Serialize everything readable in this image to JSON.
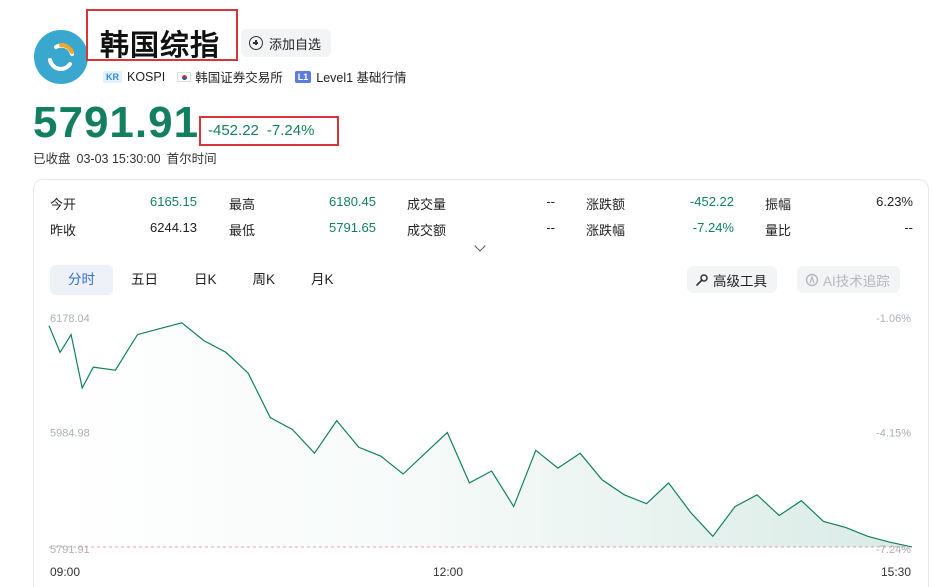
{
  "header": {
    "name": "韩国综指",
    "watch_label": "添加自选",
    "market_tag": "KR",
    "symbol": "KOSPI",
    "exchange": "韩国证券交易所",
    "level_tag": "L1",
    "level_label": "Level1 基础行情"
  },
  "quote": {
    "price": "5791.91",
    "change": "-452.22",
    "change_pct": "-7.24%",
    "status": "已收盘",
    "datetime": "03-03 15:30:00",
    "timezone": "首尔时间"
  },
  "stats": {
    "rows": [
      [
        {
          "label": "今开",
          "value": "6165.15",
          "tone": "green"
        },
        {
          "label": "最高",
          "value": "6180.45",
          "tone": "green"
        },
        {
          "label": "成交量",
          "value": "--",
          "tone": "dark"
        },
        {
          "label": "涨跌额",
          "value": "-452.22",
          "tone": "green"
        },
        {
          "label": "振幅",
          "value": "6.23%",
          "tone": "dark"
        }
      ],
      [
        {
          "label": "昨收",
          "value": "6244.13",
          "tone": "dark"
        },
        {
          "label": "最低",
          "value": "5791.65",
          "tone": "green"
        },
        {
          "label": "成交额",
          "value": "--",
          "tone": "dark"
        },
        {
          "label": "涨跌幅",
          "value": "-7.24%",
          "tone": "green"
        },
        {
          "label": "量比",
          "value": "--",
          "tone": "dark"
        }
      ]
    ]
  },
  "tabs": [
    "分时",
    "五日",
    "日K",
    "周K",
    "月K"
  ],
  "tools": {
    "advanced_label": "高级工具",
    "ai_label": "AI技术追踪"
  },
  "colors": {
    "down": "#128060",
    "accent": "#2f6fd1",
    "highlight_box": "#d6363a"
  },
  "chart_data": {
    "type": "area",
    "y_labels_left": [
      "6178.04",
      "5984.98",
      "5791.91"
    ],
    "y_labels_right": [
      "-1.06%",
      "-4.15%",
      "-7.24%"
    ],
    "x_labels": [
      "09:00",
      "12:00",
      "15:30"
    ],
    "ylim": [
      5791.91,
      6178.04
    ],
    "x": [
      "09:00",
      "09:05",
      "09:10",
      "09:15",
      "09:20",
      "09:30",
      "09:40",
      "09:50",
      "10:00",
      "10:10",
      "10:20",
      "10:30",
      "10:40",
      "10:50",
      "11:00",
      "11:10",
      "11:20",
      "11:30",
      "11:40",
      "11:50",
      "12:00",
      "12:10",
      "12:20",
      "12:30",
      "12:40",
      "12:50",
      "13:00",
      "13:10",
      "13:20",
      "13:30",
      "13:40",
      "13:50",
      "14:00",
      "14:10",
      "14:20",
      "14:30",
      "14:40",
      "14:50",
      "15:00",
      "15:10",
      "15:20",
      "15:30"
    ],
    "values": [
      6165,
      6120,
      6150,
      6060,
      6095,
      6090,
      6150,
      6160,
      6170,
      6140,
      6120,
      6085,
      6010,
      5990,
      5950,
      6005,
      5960,
      5945,
      5915,
      5950,
      5985,
      5900,
      5920,
      5860,
      5955,
      5925,
      5950,
      5905,
      5880,
      5865,
      5900,
      5850,
      5810,
      5860,
      5880,
      5845,
      5870,
      5835,
      5825,
      5810,
      5800,
      5792
    ],
    "prev_close_line": 5791.91
  }
}
